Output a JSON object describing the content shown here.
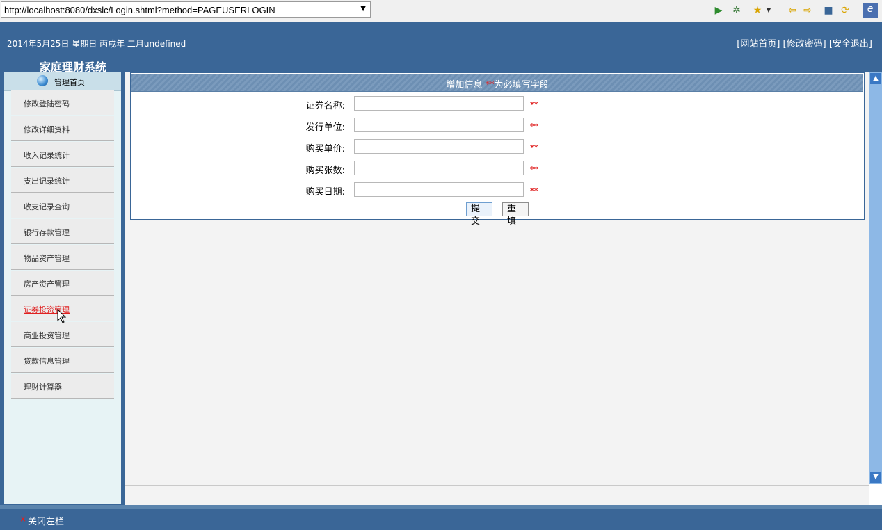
{
  "browser": {
    "url": "http://localhost:8080/dxslc/Login.shtml?method=PAGEUSERLOGIN",
    "toolbar_icons": [
      "play-icon",
      "bug-icon",
      "star-icon",
      "back-arrow-icon",
      "forward-arrow-icon",
      "stop-icon",
      "refresh-icon",
      "eclipse-icon"
    ]
  },
  "header": {
    "date": "2014年5月25日 星期日 丙戌年 二月undefined",
    "links": [
      "[网站首页]",
      "[修改密码]",
      "[安全退出]"
    ],
    "system_title": "家庭理财系统"
  },
  "sidebar": {
    "home_label": "管理首页",
    "items": [
      {
        "label": "修改登陆密码"
      },
      {
        "label": "修改详细资料"
      },
      {
        "label": "收入记录统计"
      },
      {
        "label": "支出记录统计"
      },
      {
        "label": "收支记录查询"
      },
      {
        "label": "银行存款管理"
      },
      {
        "label": "物品资产管理"
      },
      {
        "label": "房产资产管理"
      },
      {
        "label": "证券投资管理"
      },
      {
        "label": "商业投资管理"
      },
      {
        "label": "贷款信息管理"
      },
      {
        "label": "理财计算器"
      }
    ],
    "active_index": 8
  },
  "form": {
    "title_prefix": "增加信息 ",
    "title_stars": "**",
    "title_suffix": "为必填写字段",
    "fields": [
      {
        "label": "证券名称:",
        "value": "",
        "required": "**"
      },
      {
        "label": "发行单位:",
        "value": "",
        "required": "**"
      },
      {
        "label": "购买单价:",
        "value": "",
        "required": "**"
      },
      {
        "label": "购买张数:",
        "value": "",
        "required": "**"
      },
      {
        "label": "购买日期:",
        "value": "",
        "required": "**"
      }
    ],
    "submit_label": "提交",
    "reset_label": "重填"
  },
  "footer": {
    "close_mark": "×",
    "close_label": "关闭左栏"
  },
  "colors": {
    "header_blue": "#3a6697",
    "sidebar_bg": "#e7f3f5",
    "required_red": "#e02020",
    "scrollbar": "#8db8e6"
  }
}
